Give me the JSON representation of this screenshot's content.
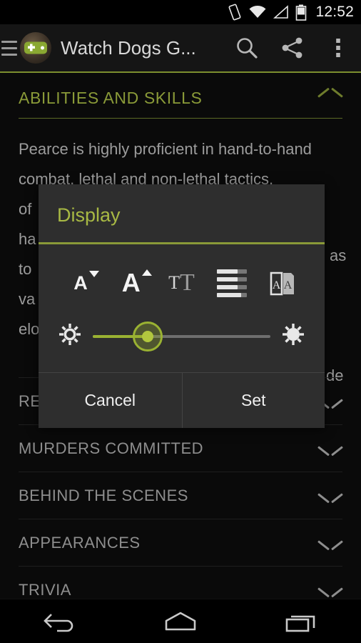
{
  "status_bar": {
    "time": "12:52",
    "icons": [
      "vibrate-icon",
      "wifi-icon",
      "signal-icon",
      "battery-icon"
    ]
  },
  "action_bar": {
    "title": "Watch Dogs G...",
    "menu_icon": "hamburger-icon",
    "avatar_icon": "app-avatar-icon",
    "search_icon": "search-icon",
    "share_icon": "share-icon",
    "overflow_icon": "overflow-menu-icon",
    "accent_color": "#7d8f2e"
  },
  "article": {
    "section_title": "ABILITIES AND SKILLS",
    "collapse_icon": "chevron-up-icon",
    "paragraph_lines": [
      "Pearce is highly proficient in hand-to-hand",
      "combat, lethal and non-lethal tactics,",
      "of",
      "ha",
      "to",
      "va",
      "elo"
    ],
    "paragraph_right_fragments": [
      "as",
      "de"
    ],
    "sections": [
      {
        "label": "RE",
        "icon": "chevron-down-icon"
      },
      {
        "label": "MURDERS COMMITTED",
        "icon": "chevron-down-icon"
      },
      {
        "label": "BEHIND THE SCENES",
        "icon": "chevron-down-icon"
      },
      {
        "label": "APPEARANCES",
        "icon": "chevron-down-icon"
      },
      {
        "label": "TRIVIA",
        "icon": "chevron-down-icon"
      }
    ]
  },
  "dialog": {
    "title": "Display",
    "accent_color": "#8a9a38",
    "background_color": "#2e2e2e",
    "icons": [
      {
        "name": "decrease-font-size-icon",
        "label": "A"
      },
      {
        "name": "increase-font-size-icon",
        "label": "A"
      },
      {
        "name": "font-family-icon",
        "label_small": "T",
        "label_large": "T"
      },
      {
        "name": "line-spacing-icon",
        "label": ""
      },
      {
        "name": "page-style-icon",
        "label": "A"
      }
    ],
    "brightness": {
      "low_icon": "brightness-low-icon",
      "high_icon": "brightness-high-icon",
      "value_percent": 31
    },
    "cancel_label": "Cancel",
    "set_label": "Set"
  },
  "nav_bar": {
    "back_icon": "back-icon",
    "home_icon": "home-icon",
    "recents_icon": "recents-icon"
  }
}
